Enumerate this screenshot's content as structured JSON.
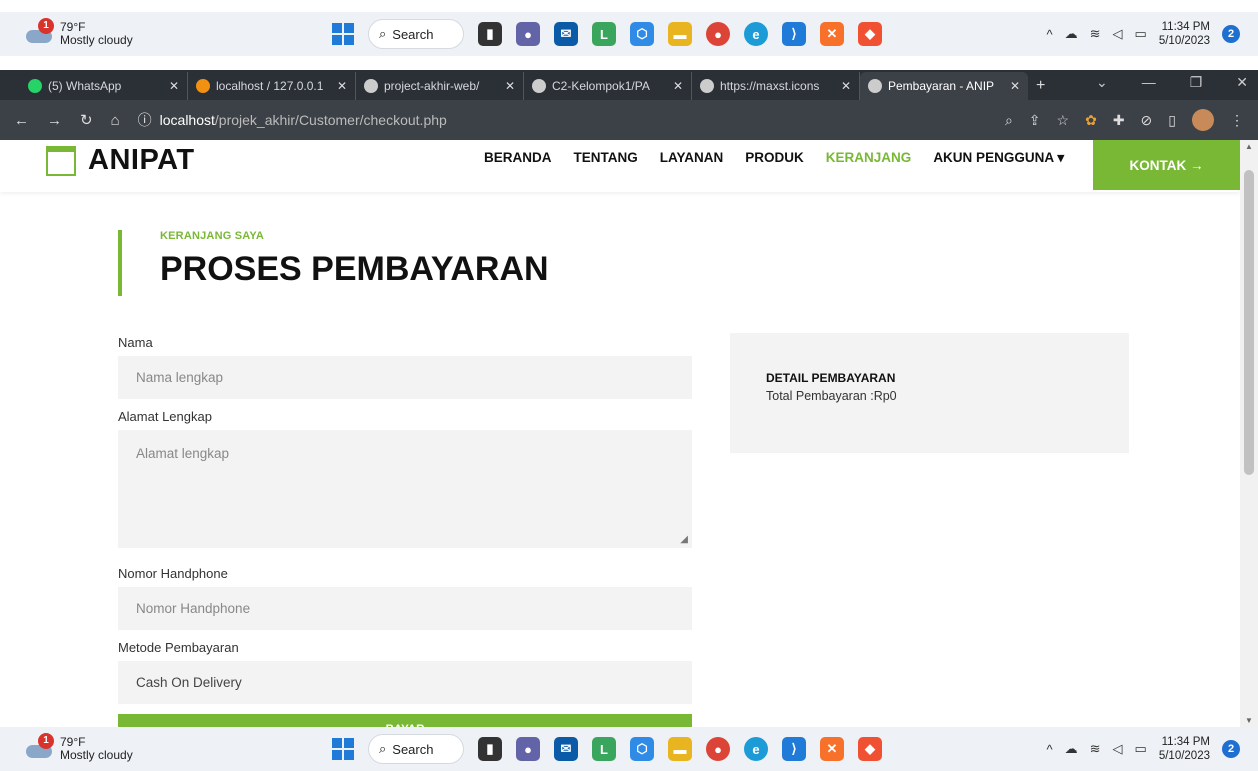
{
  "taskbar": {
    "weather_temp": "79°F",
    "weather_desc": "Mostly cloudy",
    "weather_badge": "1",
    "search_label": "Search",
    "clock_time": "11:34 PM",
    "clock_date": "5/10/2023",
    "notif_count": "2"
  },
  "browser": {
    "tabs": [
      {
        "label": "(5) WhatsApp",
        "icon_color": "#25d366"
      },
      {
        "label": "localhost / 127.0.0.1",
        "icon_color": "#f29111"
      },
      {
        "label": "project-akhir-web/",
        "icon_color": "#cccccc"
      },
      {
        "label": "C2-Kelompok1/PA",
        "icon_color": "#cccccc"
      },
      {
        "label": "https://maxst.icons",
        "icon_color": "#cccccc"
      },
      {
        "label": "Pembayaran - ANIP",
        "icon_color": "#cccccc"
      }
    ],
    "url_host": "localhost",
    "url_path": "/projek_akhir/Customer/checkout.php"
  },
  "site": {
    "brand": "ANIPAT",
    "nav": [
      "BERANDA",
      "TENTANG",
      "LAYANAN",
      "PRODUK",
      "KERANJANG",
      "AKUN PENGGUNA ▾"
    ],
    "kontak": "KONTAK →",
    "accent_color": "#79b835"
  },
  "heading": {
    "sub": "KERANJANG SAYA",
    "title": "PROSES PEMBAYARAN"
  },
  "form": {
    "nama_label": "Nama",
    "nama_placeholder": "Nama lengkap",
    "alamat_label": "Alamat Lengkap",
    "alamat_placeholder": "Alamat lengkap",
    "hp_label": "Nomor Handphone",
    "hp_placeholder": "Nomor Handphone",
    "metode_label": "Metode Pembayaran",
    "metode_value": "Cash On Delivery",
    "submit_label": "BAYAR"
  },
  "summary": {
    "title": "DETAIL PEMBAYARAN",
    "total_text": "Total Pembayaran :Rp0"
  }
}
